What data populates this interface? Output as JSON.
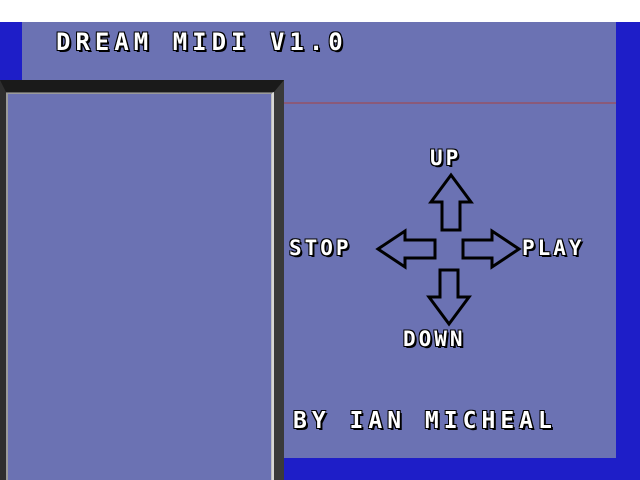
{
  "title": "DREAM MIDI V1.0",
  "controls": {
    "up": "UP",
    "stop": "STOP",
    "play": "PLAY",
    "down": "DOWN"
  },
  "credit": "BY IAN MICHEAL",
  "colors": {
    "panel": "#6b72b3",
    "frame": "#1e1ec8",
    "text": "#ffffff",
    "outline": "#000000"
  },
  "icons": {
    "up": "arrow-up-icon",
    "down": "arrow-down-icon",
    "left": "arrow-left-icon",
    "right": "arrow-right-icon"
  }
}
